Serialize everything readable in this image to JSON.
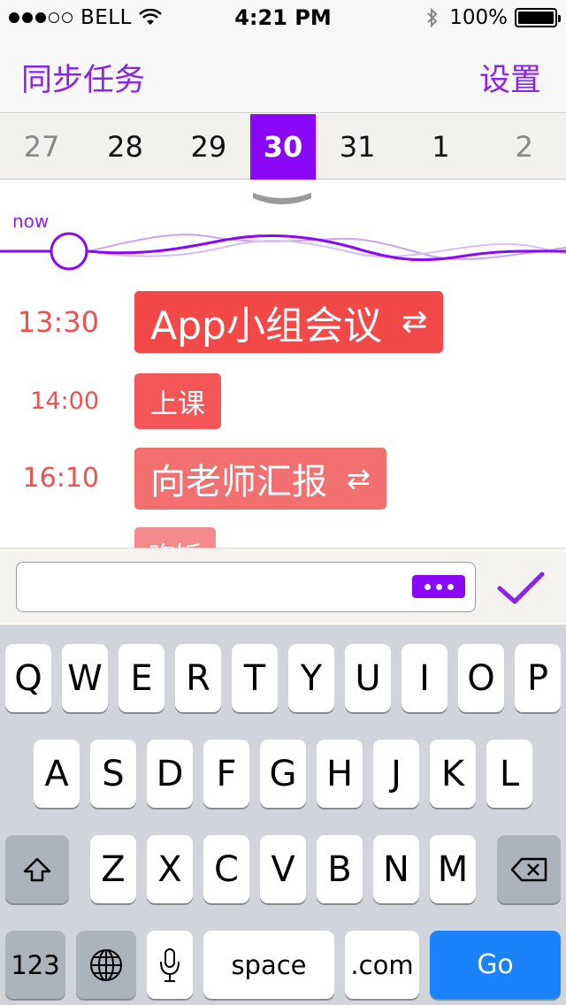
{
  "status_bar": {
    "signal_full": 3,
    "signal_total": 5,
    "carrier": "BELL",
    "time": "4:21 PM",
    "battery": "100%"
  },
  "nav": {
    "left": "同步任务",
    "right": "设置"
  },
  "date_strip": {
    "selected": "30",
    "dates": [
      {
        "label": "27",
        "muted": true
      },
      {
        "label": "28",
        "muted": false
      },
      {
        "label": "29",
        "muted": false
      },
      {
        "label": "30",
        "muted": false
      },
      {
        "label": "31",
        "muted": false
      },
      {
        "label": "1",
        "muted": false
      },
      {
        "label": "2",
        "muted": true
      }
    ]
  },
  "timeline": {
    "now_label": "now",
    "tasks": [
      {
        "time": "13:30",
        "title": "App小组会议",
        "repeat": true,
        "repeat_icon": "⇄",
        "color": "#f24848"
      },
      {
        "time": "14:00",
        "title": "上课",
        "repeat": false,
        "repeat_icon": "",
        "color": "#f25656"
      },
      {
        "time": "16:10",
        "title": "向老师汇报",
        "repeat": true,
        "repeat_icon": "⇄",
        "color": "#f27070"
      },
      {
        "time": "",
        "title": "吃饭",
        "repeat": false,
        "repeat_icon": "",
        "color": "#f58a8a"
      }
    ]
  },
  "input": {
    "value": "",
    "placeholder": ""
  },
  "keyboard": {
    "row1": [
      "Q",
      "W",
      "E",
      "R",
      "T",
      "Y",
      "U",
      "I",
      "O",
      "P"
    ],
    "row2": [
      "A",
      "S",
      "D",
      "F",
      "G",
      "H",
      "J",
      "K",
      "L"
    ],
    "row3": [
      "Z",
      "X",
      "C",
      "V",
      "B",
      "N",
      "M"
    ],
    "numbers_key": "123",
    "space_key": "space",
    "dotcom_key": ".com",
    "go_key": "Go"
  },
  "colors": {
    "accent": "#8a07f7",
    "task_red": "#f24848",
    "go_blue": "#1a82fb"
  }
}
